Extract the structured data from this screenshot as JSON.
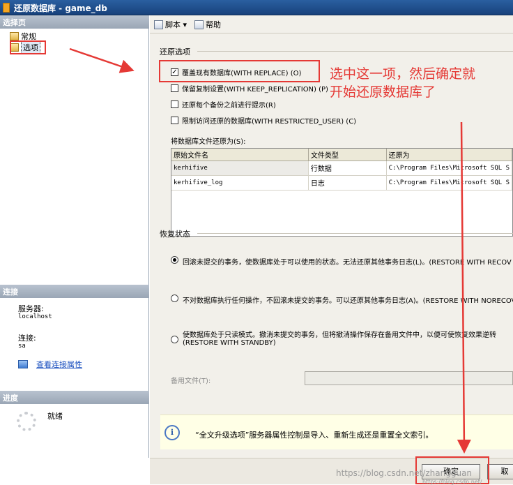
{
  "window": {
    "title": "还原数据库 - game_db"
  },
  "left_panel": {
    "select_page_header": "选择页",
    "pages": [
      {
        "label": "常规",
        "selected": false
      },
      {
        "label": "选项",
        "selected": true
      }
    ],
    "connection_header": "连接",
    "server_label": "服务器:",
    "server_value": "localhost",
    "connection_label": "连接:",
    "connection_value": "sa",
    "view_connection_link": "查看连接属性",
    "progress_header": "进度",
    "progress_status": "就绪"
  },
  "toolbar": {
    "script_label": "脚本 ▾",
    "help_label": "帮助"
  },
  "restore_options": {
    "group_label": "还原选项",
    "options": [
      {
        "label": "覆盖现有数据库(WITH REPLACE) (O)",
        "checked": true
      },
      {
        "label": "保留复制设置(WITH KEEP_REPLICATION) (P)",
        "checked": false
      },
      {
        "label": "还原每个备份之前进行提示(R)",
        "checked": false
      },
      {
        "label": "限制访问还原的数据库(WITH RESTRICTED_USER) (C)",
        "checked": false
      }
    ],
    "files_label": "将数据库文件还原为(S):",
    "columns": [
      "原始文件名",
      "文件类型",
      "还原为"
    ],
    "rows": [
      [
        "kerhifive",
        "行数据",
        "C:\\Program Files\\Microsoft SQL S"
      ],
      [
        "kerhifive_log",
        "日志",
        "C:\\Program Files\\Microsoft SQL S"
      ]
    ]
  },
  "recovery_state": {
    "group_label": "恢复状态",
    "options": [
      {
        "line1": "回滚未提交的事务，使数据库处于可以使用的状态。无法还原其他事务日志(L)。(RESTORE WITH RECOV",
        "line2": "",
        "selected": true
      },
      {
        "line1": "不对数据库执行任何操作，不回滚未提交的事务。可以还原其他事务日志(A)。(RESTORE WITH NORECOV",
        "line2": "",
        "selected": false
      },
      {
        "line1": "使数据库处于只读模式。撤消未提交的事务，但将撤消操作保存在备用文件中，以便可使恢复效果逆转",
        "line2": "(RESTORE WITH STANDBY)",
        "selected": false
      }
    ],
    "standby_file_label": "备用文件(T):"
  },
  "info_message": "“全文升级选项”服务器属性控制是导入、重新生成还是重置全文索引。",
  "buttons": {
    "ok_label": "确定",
    "cancel_label": "取"
  },
  "annotation": {
    "line1": "选中这一项，然后确定就",
    "line2": "开始还原数据库了",
    "color": "#e53935"
  },
  "watermark": "https://blog.csdn.net/zhangguan",
  "watermark2": "https://blog.csdn.net/"
}
